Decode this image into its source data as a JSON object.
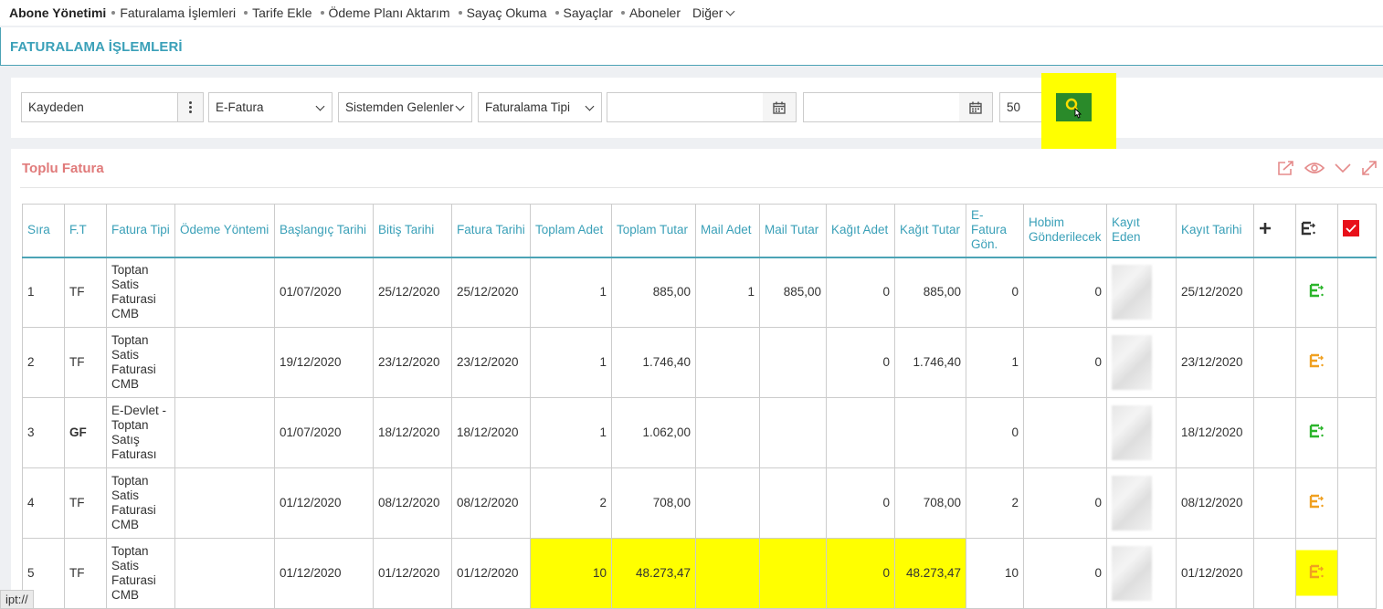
{
  "topnav": {
    "brand": "Abone Yönetimi",
    "items": [
      "Faturalama İşlemleri",
      "Tarife Ekle",
      "Ödeme Planı Aktarım",
      "Sayaç Okuma",
      "Sayaçlar",
      "Aboneler"
    ],
    "more": "Diğer"
  },
  "page_title": "FATURALAMA İŞLEMLERİ",
  "filters": {
    "kaydeden_placeholder": "Kaydeden",
    "fatura_turu": "E-Fatura",
    "kaynak": "Sistemden Gelenler",
    "faturalama_tipi": "Faturalama Tipi",
    "start_date": "",
    "end_date": "",
    "page_size": "50",
    "icons": {
      "menu": "vertical-dots-icon",
      "calendar": "calendar-icon",
      "search": "search-icon"
    }
  },
  "panel": {
    "title": "Toplu Fatura",
    "tool_icons": [
      "export-icon",
      "eye-icon",
      "chevron-down-icon",
      "expand-icon"
    ]
  },
  "table": {
    "headers": {
      "sira": "Sıra",
      "ft": "F.T",
      "fatura_tipi": "Fatura Tipi",
      "odeme": "Ödeme Yöntemi",
      "baslangic": "Başlangıç Tarihi",
      "bitis": "Bitiş Tarihi",
      "fatura_tarihi": "Fatura Tarihi",
      "toplam_adet": "Toplam Adet",
      "toplam_tutar": "Toplam Tutar",
      "mail_adet": "Mail Adet",
      "mail_tutar": "Mail Tutar",
      "kagit_adet": "Kağıt Adet",
      "kagit_tutar": "Kağıt Tutar",
      "efatura": "E-Fatura Gön.",
      "hobim": "Hobim Gönderilecek",
      "kayit_eden": "Kayıt Eden",
      "kayit_tarihi": "Kayıt Tarihi"
    },
    "rows": [
      {
        "sira": "1",
        "ft": "TF",
        "fatura_tipi": "Toptan Satis Faturasi CMB",
        "odeme": "",
        "baslangic": "01/07/2020",
        "bitis": "25/12/2020",
        "fatura_tarihi": "25/12/2020",
        "toplam_adet": "1",
        "toplam_tutar": "885,00",
        "mail_adet": "1",
        "mail_tutar": "885,00",
        "kagit_adet": "0",
        "kagit_tutar": "885,00",
        "efatura": "0",
        "hobim": "0",
        "kayit_tarihi": "25/12/2020",
        "status_color": "#2bb52b"
      },
      {
        "sira": "2",
        "ft": "TF",
        "fatura_tipi": "Toptan Satis Faturasi CMB",
        "odeme": "",
        "baslangic": "19/12/2020",
        "bitis": "23/12/2020",
        "fatura_tarihi": "23/12/2020",
        "toplam_adet": "1",
        "toplam_tutar": "1.746,40",
        "mail_adet": "",
        "mail_tutar": "",
        "kagit_adet": "0",
        "kagit_tutar": "1.746,40",
        "efatura": "1",
        "hobim": "0",
        "kayit_tarihi": "23/12/2020",
        "status_color": "#f0a020"
      },
      {
        "sira": "3",
        "ft": "GF",
        "fatura_tipi": "E-Devlet - Toptan Satış Faturası",
        "odeme": "",
        "baslangic": "01/07/2020",
        "bitis": "18/12/2020",
        "fatura_tarihi": "18/12/2020",
        "toplam_adet": "1",
        "toplam_tutar": "1.062,00",
        "mail_adet": "",
        "mail_tutar": "",
        "kagit_adet": "",
        "kagit_tutar": "",
        "efatura": "0",
        "hobim": "",
        "kayit_tarihi": "18/12/2020",
        "status_color": "#2bb52b"
      },
      {
        "sira": "4",
        "ft": "TF",
        "fatura_tipi": "Toptan Satis Faturasi CMB",
        "odeme": "",
        "baslangic": "01/12/2020",
        "bitis": "08/12/2020",
        "fatura_tarihi": "08/12/2020",
        "toplam_adet": "2",
        "toplam_tutar": "708,00",
        "mail_adet": "",
        "mail_tutar": "",
        "kagit_adet": "0",
        "kagit_tutar": "708,00",
        "efatura": "2",
        "hobim": "0",
        "kayit_tarihi": "08/12/2020",
        "status_color": "#f0a020"
      },
      {
        "sira": "5",
        "ft": "TF",
        "fatura_tipi": "Toptan Satis Faturasi CMB",
        "odeme": "",
        "baslangic": "01/12/2020",
        "bitis": "01/12/2020",
        "fatura_tarihi": "01/12/2020",
        "toplam_adet": "10",
        "toplam_tutar": "48.273,47",
        "mail_adet": "",
        "mail_tutar": "",
        "kagit_adet": "0",
        "kagit_tutar": "48.273,47",
        "efatura": "10",
        "hobim": "0",
        "kayit_tarihi": "01/12/2020",
        "status_color": "#f0a020"
      }
    ],
    "add_icon": "plus-icon",
    "send_icon": "e-invoice-send-icon",
    "check_icon": "checkbox-checked-icon"
  },
  "statusbar": "ipt://"
}
